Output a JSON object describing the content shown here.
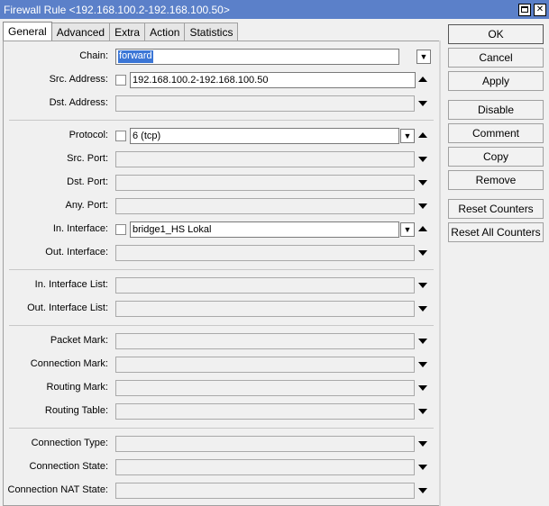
{
  "window": {
    "title": "Firewall Rule <192.168.100.2-192.168.100.50>"
  },
  "tabs": [
    "General",
    "Advanced",
    "Extra",
    "Action",
    "Statistics"
  ],
  "fields": {
    "chain": {
      "label": "Chain:",
      "value": "forward"
    },
    "src_address": {
      "label": "Src. Address:",
      "value": "192.168.100.2-192.168.100.50"
    },
    "dst_address": {
      "label": "Dst. Address:",
      "value": ""
    },
    "protocol": {
      "label": "Protocol:",
      "value": "6 (tcp)"
    },
    "src_port": {
      "label": "Src. Port:",
      "value": ""
    },
    "dst_port": {
      "label": "Dst. Port:",
      "value": ""
    },
    "any_port": {
      "label": "Any. Port:",
      "value": ""
    },
    "in_interface": {
      "label": "In. Interface:",
      "value": "bridge1_HS Lokal"
    },
    "out_interface": {
      "label": "Out. Interface:",
      "value": ""
    },
    "in_interface_list": {
      "label": "In. Interface List:",
      "value": ""
    },
    "out_interface_list": {
      "label": "Out. Interface List:",
      "value": ""
    },
    "packet_mark": {
      "label": "Packet Mark:",
      "value": ""
    },
    "connection_mark": {
      "label": "Connection Mark:",
      "value": ""
    },
    "routing_mark": {
      "label": "Routing Mark:",
      "value": ""
    },
    "routing_table": {
      "label": "Routing Table:",
      "value": ""
    },
    "connection_type": {
      "label": "Connection Type:",
      "value": ""
    },
    "connection_state": {
      "label": "Connection State:",
      "value": ""
    },
    "connection_nat_state": {
      "label": "Connection NAT State:",
      "value": ""
    }
  },
  "buttons": {
    "ok": "OK",
    "cancel": "Cancel",
    "apply": "Apply",
    "disable": "Disable",
    "comment": "Comment",
    "copy": "Copy",
    "remove": "Remove",
    "reset_counters": "Reset Counters",
    "reset_all_counters": "Reset All Counters"
  },
  "colors": {
    "titlebar": "#5b80c9",
    "selection": "#3b76d6"
  }
}
